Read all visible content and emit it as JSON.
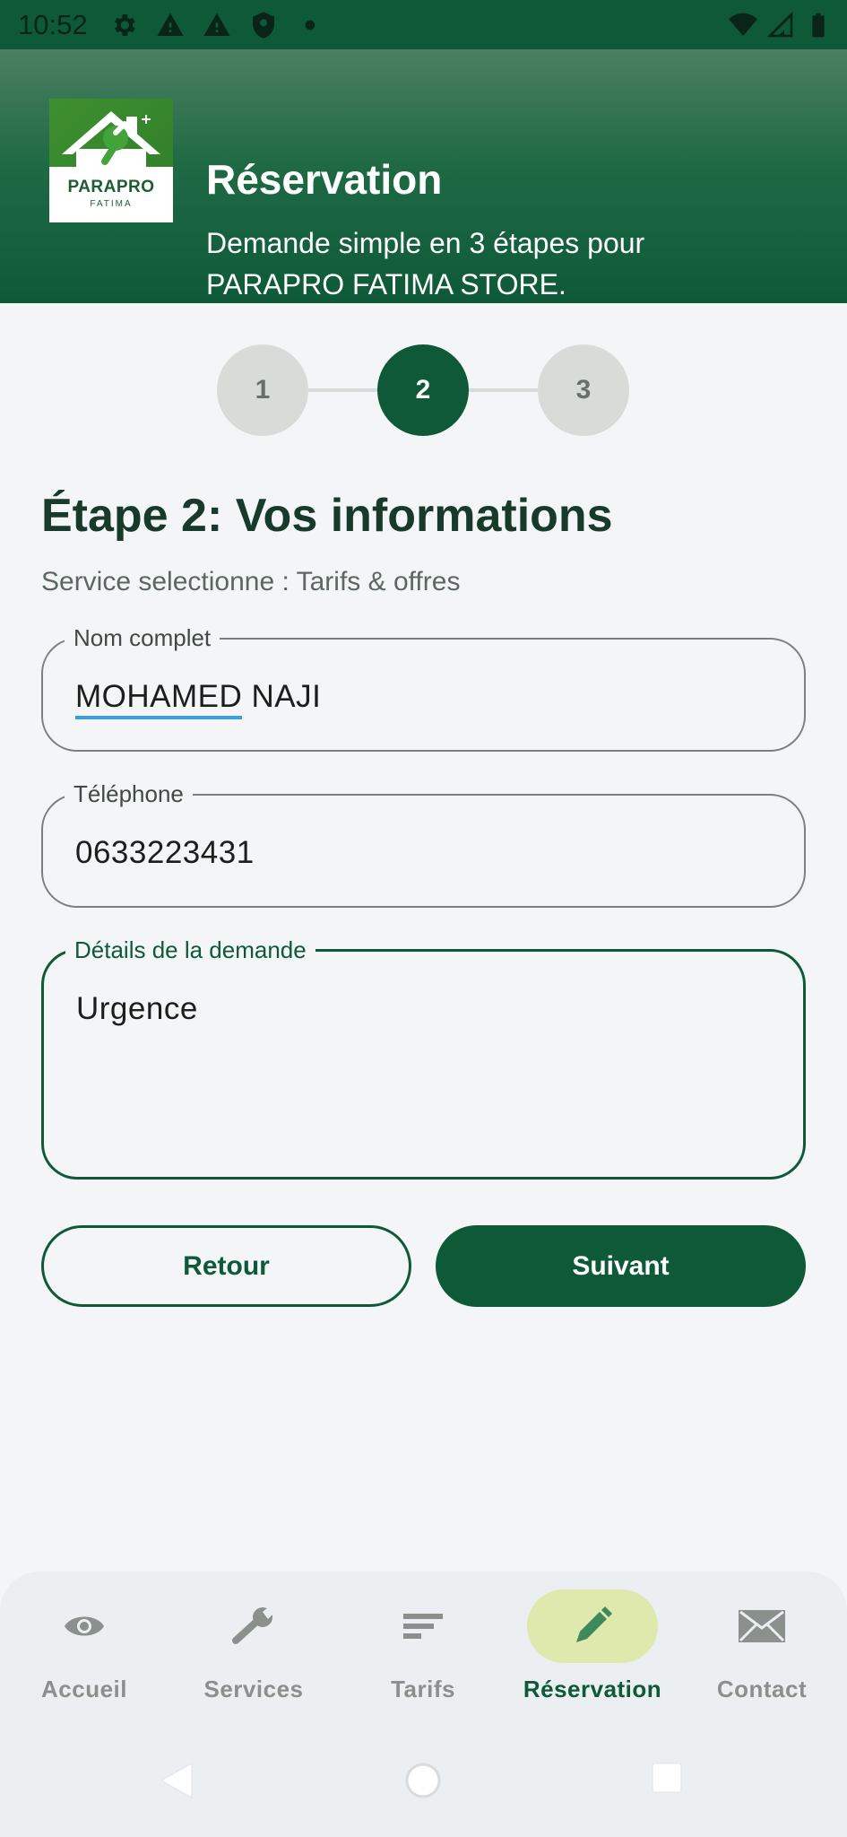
{
  "status_bar": {
    "time": "10:52",
    "left_icons": [
      "gear-icon",
      "warning-icon",
      "warning-icon",
      "shield-icon",
      "dot-icon"
    ],
    "right_icons": [
      "wifi-icon",
      "signal-icon",
      "battery-icon"
    ]
  },
  "header": {
    "logo_title": "PARAPRO",
    "logo_subtitle": "FATIMA",
    "title": "Réservation",
    "subtitle": "Demande simple en 3 étapes pour PARAPRO FATIMA STORE."
  },
  "stepper": {
    "steps": [
      "1",
      "2",
      "3"
    ],
    "active_step": 2
  },
  "form": {
    "title": "Étape 2: Vos informations",
    "service_line": "Service selectionne : Tarifs & offres",
    "full_name": {
      "label": "Nom complet",
      "value_first": "MOHAMED",
      "value_rest": " NAJI"
    },
    "phone": {
      "label": "Téléphone",
      "value": "0633223431"
    },
    "details": {
      "label": "Détails de la demande",
      "value": "Urgence"
    }
  },
  "actions": {
    "back_label": "Retour",
    "next_label": "Suivant"
  },
  "bottom_nav": {
    "items": [
      {
        "label": "Accueil",
        "icon": "eye-icon"
      },
      {
        "label": "Services",
        "icon": "wrench-icon"
      },
      {
        "label": "Tarifs",
        "icon": "lines-icon"
      },
      {
        "label": "Réservation",
        "icon": "pencil-icon"
      },
      {
        "label": "Contact",
        "icon": "envelope-icon"
      }
    ],
    "active_index": 3
  },
  "system_nav": [
    "back-icon",
    "home-icon",
    "recents-icon"
  ],
  "colors": {
    "primary": "#0e5a38",
    "active_pill": "#dfe8ad",
    "background": "#f3f5f7"
  }
}
